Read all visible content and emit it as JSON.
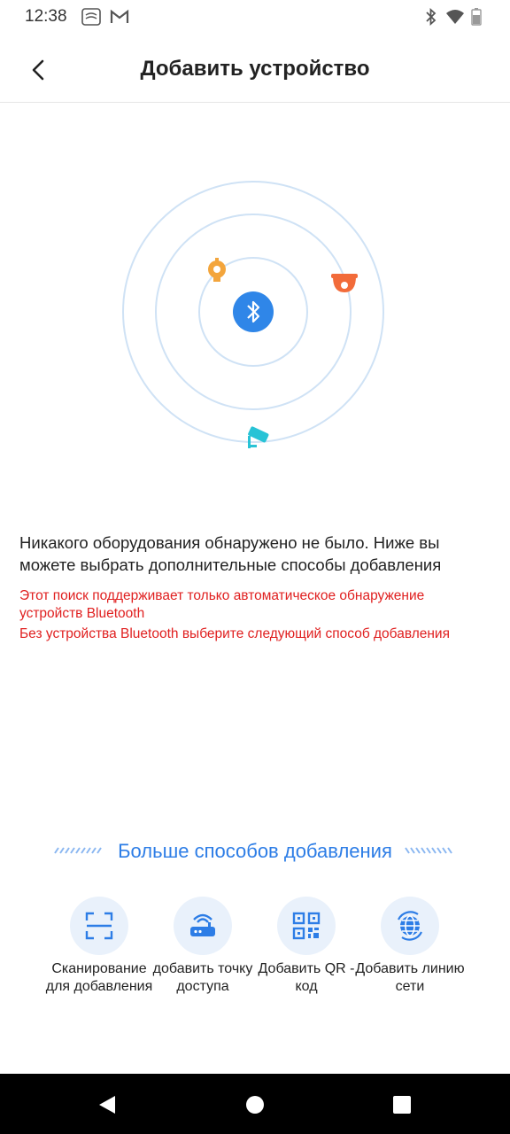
{
  "status_bar": {
    "time": "12:38",
    "icons": [
      "app-notification-icon",
      "gmail-icon",
      "bluetooth-icon",
      "wifi-icon",
      "battery-icon"
    ]
  },
  "header": {
    "title": "Добавить устройство",
    "back_icon": "chevron-left-icon"
  },
  "radar": {
    "center_icon": "bluetooth-icon",
    "device_icons": [
      "smart-plug-icon",
      "dome-camera-icon",
      "bullet-camera-icon"
    ],
    "colors": {
      "ring": "#cfe2f5",
      "center": "#2f86e8",
      "plug": "#f3a53c",
      "dome": "#f26b3a",
      "bullet": "#28c3d6"
    }
  },
  "message": {
    "main": "Никакого оборудования обнаружено не было. Ниже вы можете выбрать дополнительные способы добавления",
    "warning1": "Этот поиск поддерживает только автоматическое обнаружение устройств Bluetooth",
    "warning2": "Без устройства Bluetooth выберите следующий способ добавления"
  },
  "more": {
    "title": "Больше способов добавления"
  },
  "methods": [
    {
      "icon": "scan-icon",
      "label": "Сканирование для добавления"
    },
    {
      "icon": "router-icon",
      "label": "добавить точку доступа"
    },
    {
      "icon": "qr-code-icon",
      "label": "Добавить QR - код"
    },
    {
      "icon": "globe-network-icon",
      "label": "Добавить линию сети"
    }
  ],
  "colors": {
    "accent": "#2d7de6",
    "warning": "#e02020",
    "icon_bg": "#e9f1fb"
  }
}
